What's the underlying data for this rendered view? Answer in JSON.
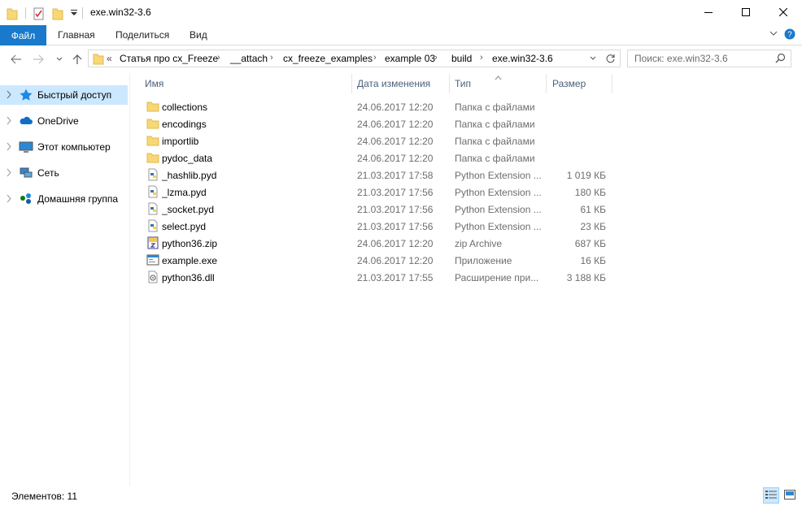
{
  "window": {
    "title": "exe.win32-3.6",
    "minimize_icon": "minimize-icon",
    "maximize_icon": "maximize-icon",
    "close_icon": "close-icon"
  },
  "ribbon": {
    "tabs": {
      "file": "Файл",
      "home": "Главная",
      "share": "Поделиться",
      "view": "Вид"
    }
  },
  "address": {
    "overflow": "«",
    "crumbs": [
      "Статья про cx_Freeze",
      "__attach",
      "cx_freeze_examples",
      "example 03",
      "build",
      "exe.win32-3.6"
    ]
  },
  "search": {
    "placeholder": "Поиск: exe.win32-3.6"
  },
  "navpane": {
    "items": [
      {
        "label": "Быстрый доступ",
        "icon": "star-icon",
        "selected": true
      },
      {
        "label": "OneDrive",
        "icon": "cloud-icon"
      },
      {
        "label": "Этот компьютер",
        "icon": "computer-icon"
      },
      {
        "label": "Сеть",
        "icon": "network-icon"
      },
      {
        "label": "Домашняя группа",
        "icon": "homegroup-icon"
      }
    ]
  },
  "columns": {
    "name": "Имя",
    "date": "Дата изменения",
    "type": "Тип",
    "size": "Размер"
  },
  "files": [
    {
      "name": "collections",
      "date": "24.06.2017 12:20",
      "type": "Папка с файлами",
      "size": "",
      "icon": "folder-icon"
    },
    {
      "name": "encodings",
      "date": "24.06.2017 12:20",
      "type": "Папка с файлами",
      "size": "",
      "icon": "folder-icon"
    },
    {
      "name": "importlib",
      "date": "24.06.2017 12:20",
      "type": "Папка с файлами",
      "size": "",
      "icon": "folder-icon"
    },
    {
      "name": "pydoc_data",
      "date": "24.06.2017 12:20",
      "type": "Папка с файлами",
      "size": "",
      "icon": "folder-icon"
    },
    {
      "name": "_hashlib.pyd",
      "date": "21.03.2017 17:58",
      "type": "Python Extension ...",
      "size": "1 019 КБ",
      "icon": "python-file-icon"
    },
    {
      "name": "_lzma.pyd",
      "date": "21.03.2017 17:56",
      "type": "Python Extension ...",
      "size": "180 КБ",
      "icon": "python-file-icon"
    },
    {
      "name": "_socket.pyd",
      "date": "21.03.2017 17:56",
      "type": "Python Extension ...",
      "size": "61 КБ",
      "icon": "python-file-icon"
    },
    {
      "name": "select.pyd",
      "date": "21.03.2017 17:56",
      "type": "Python Extension ...",
      "size": "23 КБ",
      "icon": "python-file-icon"
    },
    {
      "name": "python36.zip",
      "date": "24.06.2017 12:20",
      "type": "zip Archive",
      "size": "687 КБ",
      "icon": "zip-icon"
    },
    {
      "name": "example.exe",
      "date": "24.06.2017 12:20",
      "type": "Приложение",
      "size": "16 КБ",
      "icon": "exe-icon"
    },
    {
      "name": "python36.dll",
      "date": "21.03.2017 17:55",
      "type": "Расширение при...",
      "size": "3 188 КБ",
      "icon": "dll-icon"
    }
  ],
  "status": {
    "count": "Элементов: 11"
  },
  "colors": {
    "accent": "#1979ca",
    "selection": "#cce8ff",
    "header_text": "#4c607a",
    "secondary_text": "#6d6d6d"
  }
}
